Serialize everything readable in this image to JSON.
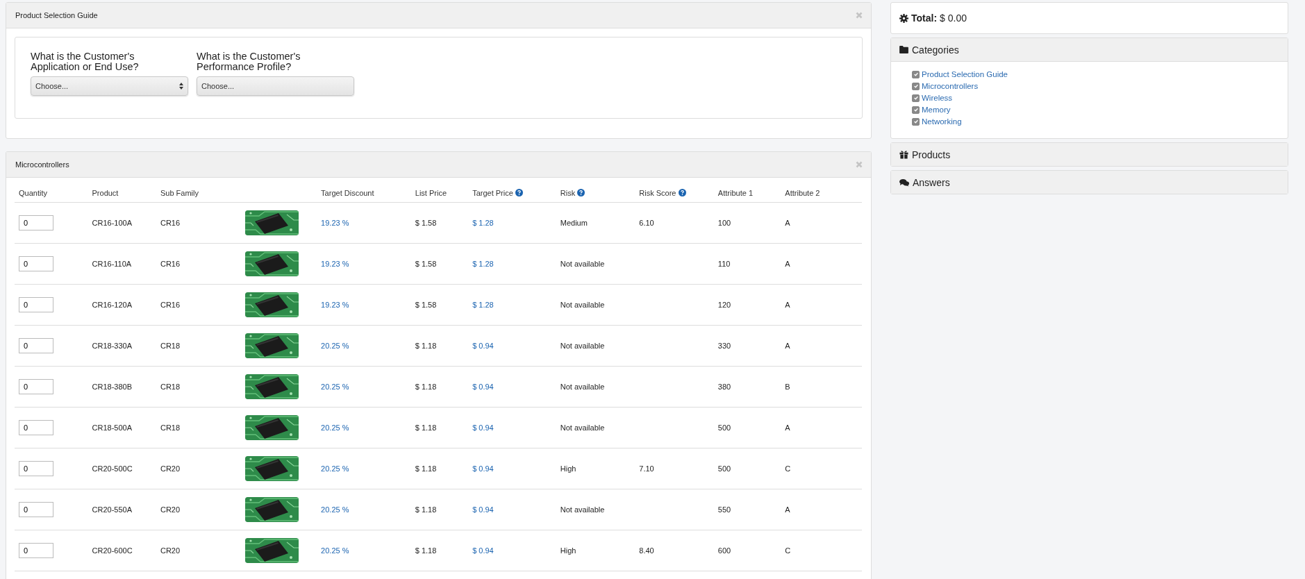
{
  "guide_panel": {
    "title": "Product Selection Guide",
    "questions": [
      {
        "label": "What is the Customer's Application or End Use?",
        "placeholder": "Choose..."
      },
      {
        "label": "What is the Customer's Performance Profile?",
        "placeholder": "Choose..."
      }
    ]
  },
  "product_panel": {
    "title": "Microcontrollers",
    "columns": [
      {
        "kind": "text",
        "label": "Quantity",
        "help": false
      },
      {
        "kind": "text",
        "label": "Product",
        "help": false
      },
      {
        "kind": "text",
        "label": "Sub Family",
        "help": false
      },
      {
        "kind": "picture"
      },
      {
        "kind": "text",
        "label": "Target Discount",
        "help": false
      },
      {
        "kind": "text",
        "label": "List Price",
        "help": false
      },
      {
        "kind": "text",
        "label": "Target Price",
        "help": true
      },
      {
        "kind": "text",
        "label": "Risk",
        "help": true
      },
      {
        "kind": "text",
        "label": "Risk Score",
        "help": true
      },
      {
        "kind": "text",
        "label": "Attribute 1",
        "help": false
      },
      {
        "kind": "text",
        "label": "Attribute 2",
        "help": false
      }
    ],
    "rows": [
      {
        "quantity": "0",
        "product": "CR16-100A",
        "sub_family": "CR16",
        "target_discount": "19.23 %",
        "list_price": "$ 1.58",
        "target_price": "$ 1.28",
        "risk": "Medium",
        "risk_score": "6.10",
        "attribute_1": "100",
        "attribute_2": "A"
      },
      {
        "quantity": "0",
        "product": "CR16-110A",
        "sub_family": "CR16",
        "target_discount": "19.23 %",
        "list_price": "$ 1.58",
        "target_price": "$ 1.28",
        "risk": "Not available",
        "attribute_1": "110",
        "attribute_2": "A"
      },
      {
        "quantity": "0",
        "product": "CR16-120A",
        "sub_family": "CR16",
        "target_discount": "19.23 %",
        "list_price": "$ 1.58",
        "target_price": "$ 1.28",
        "risk": "Not available",
        "attribute_1": "120",
        "attribute_2": "A"
      },
      {
        "quantity": "0",
        "product": "CR18-330A",
        "sub_family": "CR18",
        "target_discount": "20.25 %",
        "list_price": "$ 1.18",
        "target_price": "$ 0.94",
        "risk": "Not available",
        "attribute_1": "330",
        "attribute_2": "A"
      },
      {
        "quantity": "0",
        "product": "CR18-380B",
        "sub_family": "CR18",
        "target_discount": "20.25 %",
        "list_price": "$ 1.18",
        "target_price": "$ 0.94",
        "risk": "Not available",
        "attribute_1": "380",
        "attribute_2": "B"
      },
      {
        "quantity": "0",
        "product": "CR18-500A",
        "sub_family": "CR18",
        "target_discount": "20.25 %",
        "list_price": "$ 1.18",
        "target_price": "$ 0.94",
        "risk": "Not available",
        "attribute_1": "500",
        "attribute_2": "A"
      },
      {
        "quantity": "0",
        "product": "CR20-500C",
        "sub_family": "CR20",
        "target_discount": "20.25 %",
        "list_price": "$ 1.18",
        "target_price": "$ 0.94",
        "risk": "High",
        "risk_score": "7.10",
        "attribute_1": "500",
        "attribute_2": "C"
      },
      {
        "quantity": "0",
        "product": "CR20-550A",
        "sub_family": "CR20",
        "target_discount": "20.25 %",
        "list_price": "$ 1.18",
        "target_price": "$ 0.94",
        "risk": "Not available",
        "attribute_1": "550",
        "attribute_2": "A"
      },
      {
        "quantity": "0",
        "product": "CR20-600C",
        "sub_family": "CR20",
        "target_discount": "20.25 %",
        "list_price": "$ 1.18",
        "target_price": "$ 0.94",
        "risk": "High",
        "risk_score": "8.40",
        "attribute_1": "600",
        "attribute_2": "C"
      }
    ]
  },
  "sidebar": {
    "total": {
      "label": "Total:",
      "value": "$ 0.00"
    },
    "categories": {
      "title": "Categories",
      "items": [
        {
          "label": "Product Selection Guide",
          "checked": true
        },
        {
          "label": "Microcontrollers",
          "checked": true
        },
        {
          "label": "Wireless",
          "checked": true
        },
        {
          "label": "Memory",
          "checked": true
        },
        {
          "label": "Networking",
          "checked": true
        }
      ]
    },
    "sections": [
      {
        "kind": "products",
        "title": "Products"
      },
      {
        "kind": "answers",
        "title": "Answers"
      }
    ]
  }
}
